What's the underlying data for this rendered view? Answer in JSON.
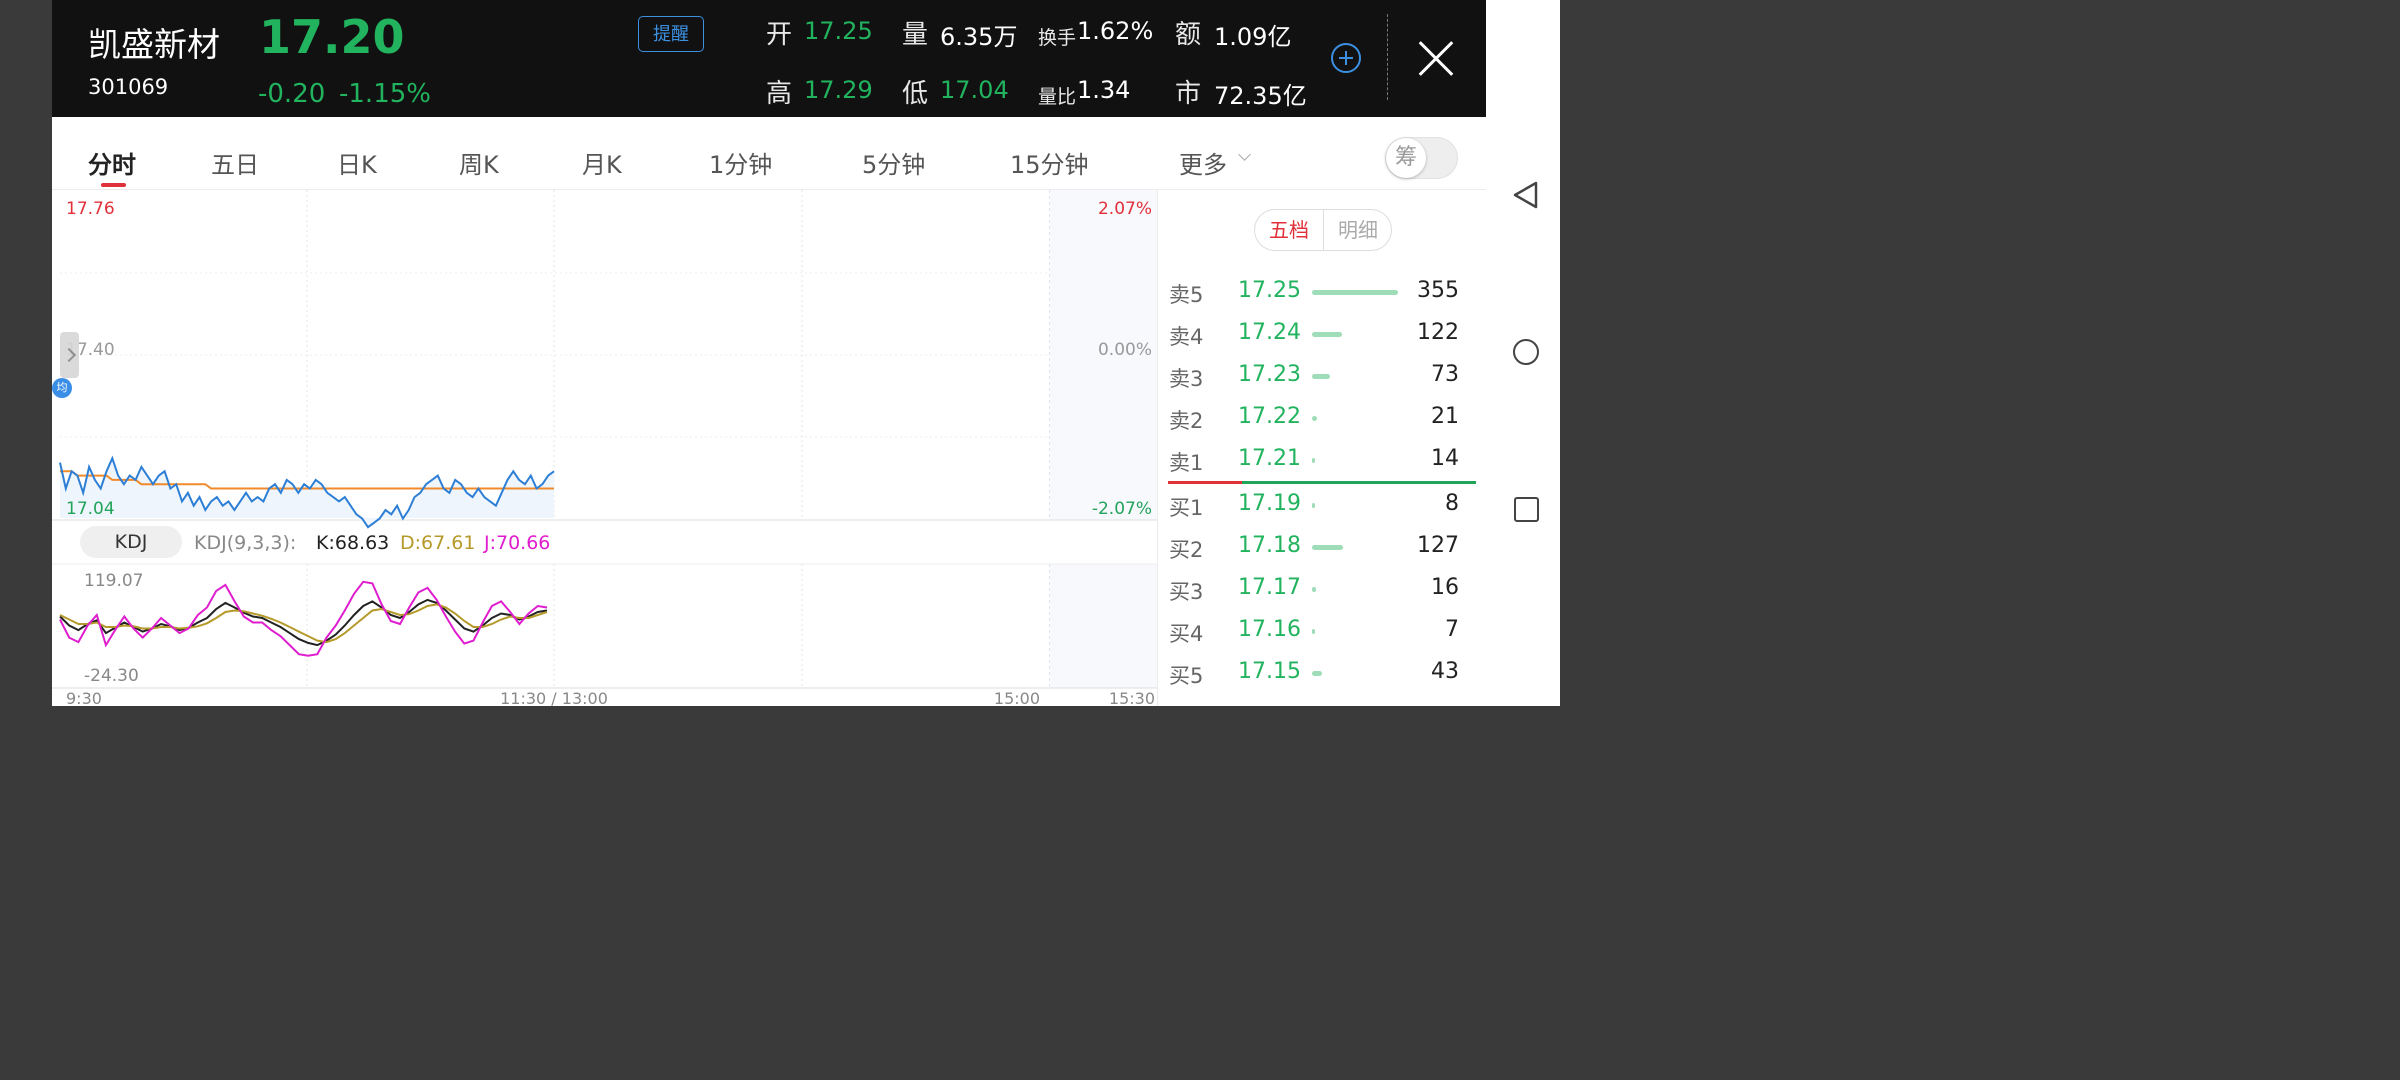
{
  "header": {
    "stock_name": "凯盛新材",
    "stock_code": "301069",
    "last_price": "17.20",
    "change": "-0.20",
    "change_pct": "-1.15%",
    "alert_label": "提醒",
    "quote": {
      "open_label": "开",
      "open": "17.25",
      "volume_label": "量",
      "volume": "6.35万",
      "turnover_label": "换手",
      "turnover": "1.62%",
      "amount_label": "额",
      "amount": "1.09亿",
      "high_label": "高",
      "high": "17.29",
      "low_label": "低",
      "low": "17.04",
      "vol_ratio_label": "量比",
      "vol_ratio": "1.34",
      "mktcap_label": "市",
      "mktcap": "72.35亿"
    },
    "icons": {
      "add": "plus-circle-icon",
      "close": "close-icon"
    },
    "accent_color": "#3d8fe0",
    "down_color": "#22b35e",
    "up_color": "#e0313b"
  },
  "tabs": {
    "items": [
      "分时",
      "五日",
      "日K",
      "周K",
      "月K",
      "1分钟",
      "5分钟",
      "15分钟",
      "更多"
    ],
    "active": "分时",
    "chip_toggle_label": "筹"
  },
  "chart": {
    "price_top": "17.76",
    "price_mid": "17.40",
    "price_bottom": "17.04",
    "pct_top": "2.07%",
    "pct_mid": "0.00%",
    "pct_bottom": "-2.07%",
    "avg_badge": "均",
    "kdj": {
      "chip": "KDJ",
      "params": "KDJ(9,3,3):",
      "k": "K:68.63",
      "d": "D:67.61",
      "j": "J:70.66",
      "top": "119.07",
      "bottom": "-24.30"
    },
    "time_labels": [
      "9:30",
      "11:30 / 13:00",
      "15:00",
      "15:30"
    ]
  },
  "chart_data": {
    "type": "line",
    "title": "",
    "ylim": [
      17.04,
      17.76
    ],
    "prev_close": 17.4,
    "series": [
      {
        "name": "",
        "color": "#2d7fd6",
        "values": [
          17.15,
          17.09,
          17.13,
          17.12,
          17.08,
          17.14,
          17.11,
          17.09,
          17.13,
          17.16,
          17.12,
          17.1,
          17.12,
          17.11,
          17.14,
          17.12,
          17.1,
          17.12,
          17.13,
          17.09,
          17.1,
          17.06,
          17.08,
          17.05,
          17.07,
          17.04,
          17.06,
          17.07,
          17.05,
          17.06,
          17.04,
          17.06,
          17.08,
          17.06,
          17.07,
          17.06,
          17.09,
          17.1,
          17.08,
          17.11,
          17.1,
          17.08,
          17.1,
          17.09,
          17.11,
          17.1,
          17.08,
          17.07,
          17.06,
          17.07,
          17.05,
          17.03,
          17.02,
          17.0,
          17.01,
          17.02,
          17.04,
          17.03,
          17.05,
          17.02,
          17.04,
          17.07,
          17.08,
          17.1,
          17.11,
          17.12,
          17.09,
          17.08,
          17.11,
          17.1,
          17.08,
          17.07,
          17.09,
          17.07,
          17.06,
          17.05,
          17.08,
          17.11,
          17.13,
          17.11,
          17.1,
          17.12,
          17.09,
          17.1,
          17.12,
          17.13
        ],
        "note_index_range": [
          0,
          85
        ]
      },
      {
        "name": "",
        "color": "#f08a2a",
        "values": [
          17.13,
          17.13,
          17.13,
          17.12,
          17.12,
          17.12,
          17.12,
          17.12,
          17.12,
          17.11,
          17.11,
          17.11,
          17.11,
          17.11,
          17.1,
          17.1,
          17.1,
          17.1,
          17.1,
          17.1,
          17.1,
          17.1,
          17.1,
          17.1,
          17.1,
          17.1,
          17.09,
          17.09,
          17.09,
          17.09,
          17.09,
          17.09,
          17.09,
          17.09,
          17.09,
          17.09,
          17.09,
          17.09,
          17.09,
          17.09,
          17.09,
          17.09,
          17.09,
          17.09,
          17.09,
          17.09,
          17.09,
          17.09,
          17.09,
          17.09,
          17.09,
          17.09,
          17.09,
          17.09,
          17.09,
          17.09,
          17.09,
          17.09,
          17.09,
          17.09,
          17.09,
          17.09,
          17.09,
          17.09,
          17.09,
          17.09,
          17.09,
          17.09,
          17.09,
          17.09,
          17.09,
          17.09,
          17.09,
          17.09,
          17.09,
          17.09,
          17.09,
          17.09,
          17.09,
          17.09,
          17.09,
          17.09,
          17.09,
          17.09,
          17.09,
          17.09
        ]
      }
    ],
    "kdj": {
      "ylim": [
        -24.3,
        119.07
      ],
      "series": [
        {
          "name": "K",
          "color": "#222222",
          "values": [
            60,
            48,
            42,
            50,
            55,
            38,
            45,
            52,
            46,
            40,
            44,
            50,
            47,
            42,
            45,
            52,
            58,
            70,
            78,
            72,
            65,
            60,
            58,
            52,
            46,
            38,
            30,
            25,
            22,
            28,
            36,
            48,
            62,
            74,
            80,
            72,
            62,
            58,
            66,
            76,
            82,
            78,
            68,
            56,
            44,
            40,
            48,
            58,
            64,
            62,
            56,
            60,
            66,
            68
          ]
        },
        {
          "name": "D",
          "color": "#b59a2a",
          "values": [
            62,
            56,
            50,
            50,
            52,
            46,
            46,
            48,
            47,
            44,
            44,
            46,
            46,
            44,
            45,
            47,
            51,
            58,
            66,
            68,
            67,
            64,
            61,
            57,
            52,
            46,
            40,
            34,
            28,
            26,
            30,
            38,
            48,
            58,
            68,
            70,
            66,
            62,
            63,
            68,
            74,
            76,
            72,
            64,
            54,
            46,
            46,
            50,
            56,
            60,
            58,
            58,
            62,
            66
          ]
        },
        {
          "name": "J",
          "color": "#e01ccf",
          "values": [
            56,
            32,
            26,
            48,
            62,
            22,
            42,
            60,
            44,
            32,
            44,
            58,
            48,
            38,
            44,
            62,
            72,
            94,
            102,
            80,
            60,
            52,
            52,
            42,
            34,
            22,
            10,
            8,
            10,
            32,
            48,
            68,
            90,
            106,
            104,
            76,
            54,
            50,
            72,
            92,
            98,
            82,
            60,
            40,
            24,
            28,
            52,
            74,
            80,
            66,
            50,
            64,
            74,
            72
          ]
        }
      ]
    }
  },
  "order_book": {
    "tabs": [
      "五档",
      "明细"
    ],
    "active_tab": "五档",
    "asks": [
      {
        "label": "卖5",
        "price": "17.25",
        "volume": "355"
      },
      {
        "label": "卖4",
        "price": "17.24",
        "volume": "122"
      },
      {
        "label": "卖3",
        "price": "17.23",
        "volume": "73"
      },
      {
        "label": "卖2",
        "price": "17.22",
        "volume": "21"
      },
      {
        "label": "卖1",
        "price": "17.21",
        "volume": "14"
      }
    ],
    "bids": [
      {
        "label": "买1",
        "price": "17.19",
        "volume": "8"
      },
      {
        "label": "买2",
        "price": "17.18",
        "volume": "127"
      },
      {
        "label": "买3",
        "price": "17.17",
        "volume": "16"
      },
      {
        "label": "买4",
        "price": "17.16",
        "volume": "7"
      },
      {
        "label": "买5",
        "price": "17.15",
        "volume": "43"
      }
    ]
  },
  "system_nav": {
    "back": "back-triangle-icon",
    "home": "home-circle-icon",
    "recent": "recent-square-icon"
  }
}
